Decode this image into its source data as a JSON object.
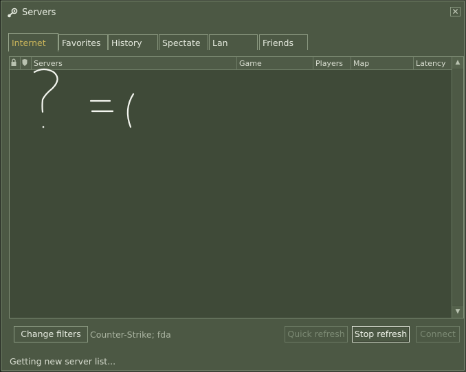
{
  "window": {
    "title": "Servers",
    "close_glyph": "✕"
  },
  "tabs": [
    {
      "label": "Internet",
      "active": true
    },
    {
      "label": "Favorites",
      "active": false
    },
    {
      "label": "History",
      "active": false
    },
    {
      "label": "Spectate",
      "active": false
    },
    {
      "label": "Lan",
      "active": false
    },
    {
      "label": "Friends",
      "active": false
    }
  ],
  "table": {
    "headers": {
      "lock_icon": "lock-icon",
      "shield_icon": "shield-icon",
      "servers": "Servers",
      "game": "Game",
      "players": "Players",
      "map": "Map",
      "latency": "Latency"
    },
    "rows": []
  },
  "overlay_drawing": {
    "text": "? =("
  },
  "bottom": {
    "change_filters": "Change filters",
    "filter_summary": "Counter-Strike; fda",
    "quick_refresh": "Quick refresh",
    "stop_refresh": "Stop refresh",
    "connect": "Connect"
  },
  "status": {
    "text": "Getting new server list..."
  },
  "colors": {
    "active_tab": "#c9b45a",
    "background": "#4c5844",
    "list_bg": "#3f4a38"
  }
}
